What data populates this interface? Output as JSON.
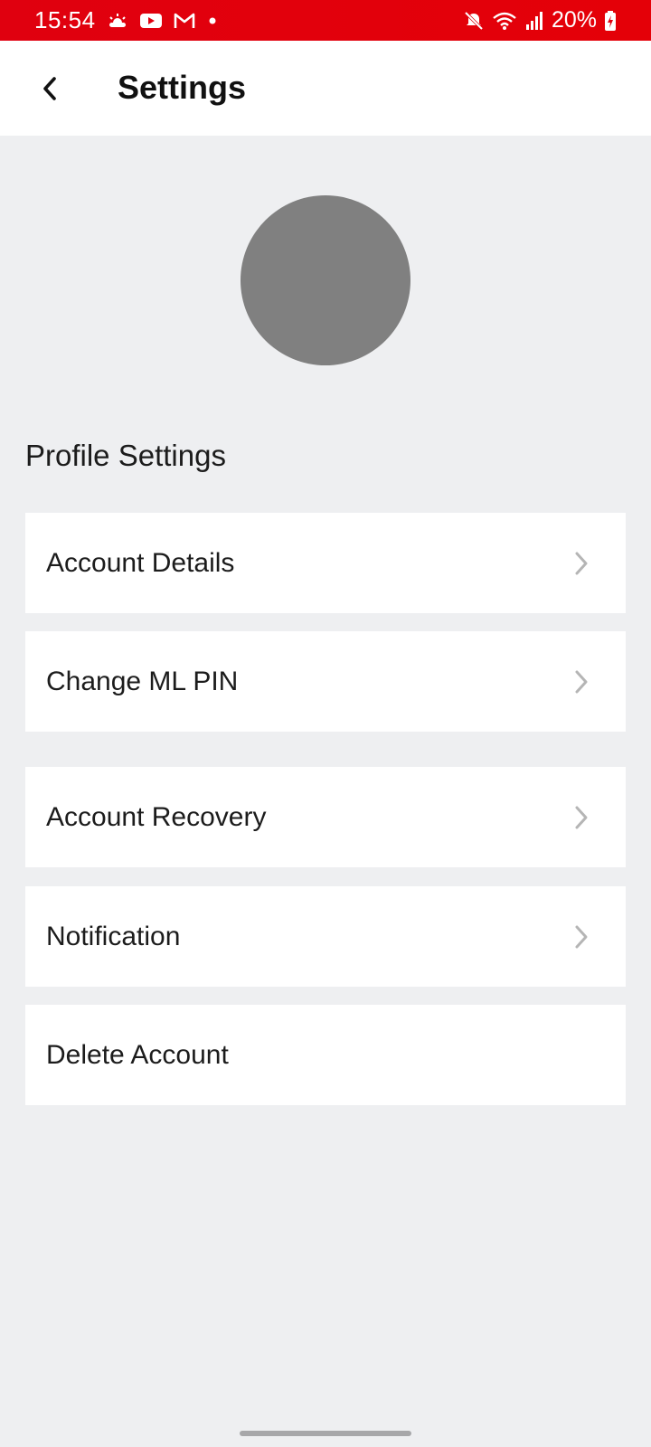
{
  "status_bar": {
    "time": "15:54",
    "left_icons": [
      "weather-icon",
      "youtube-icon",
      "gmail-icon",
      "dot-icon"
    ],
    "right_icons": [
      "mute-icon",
      "wifi-icon",
      "signal-icon"
    ],
    "battery": "20%"
  },
  "header": {
    "title": "Settings"
  },
  "profile": {
    "section_title": "Profile Settings"
  },
  "menu": {
    "items": [
      {
        "label": "Account Details",
        "has_chevron": true
      },
      {
        "label": "Change ML PIN",
        "has_chevron": true
      },
      {
        "label": "Account Recovery",
        "has_chevron": true
      },
      {
        "label": "Notification",
        "has_chevron": true
      },
      {
        "label": "Delete Account",
        "has_chevron": false
      }
    ]
  },
  "colors": {
    "status_bar": "#e0000f",
    "background": "#eeeff1",
    "card": "#ffffff",
    "avatar": "#808080",
    "chevron": "#b5b5b5"
  }
}
